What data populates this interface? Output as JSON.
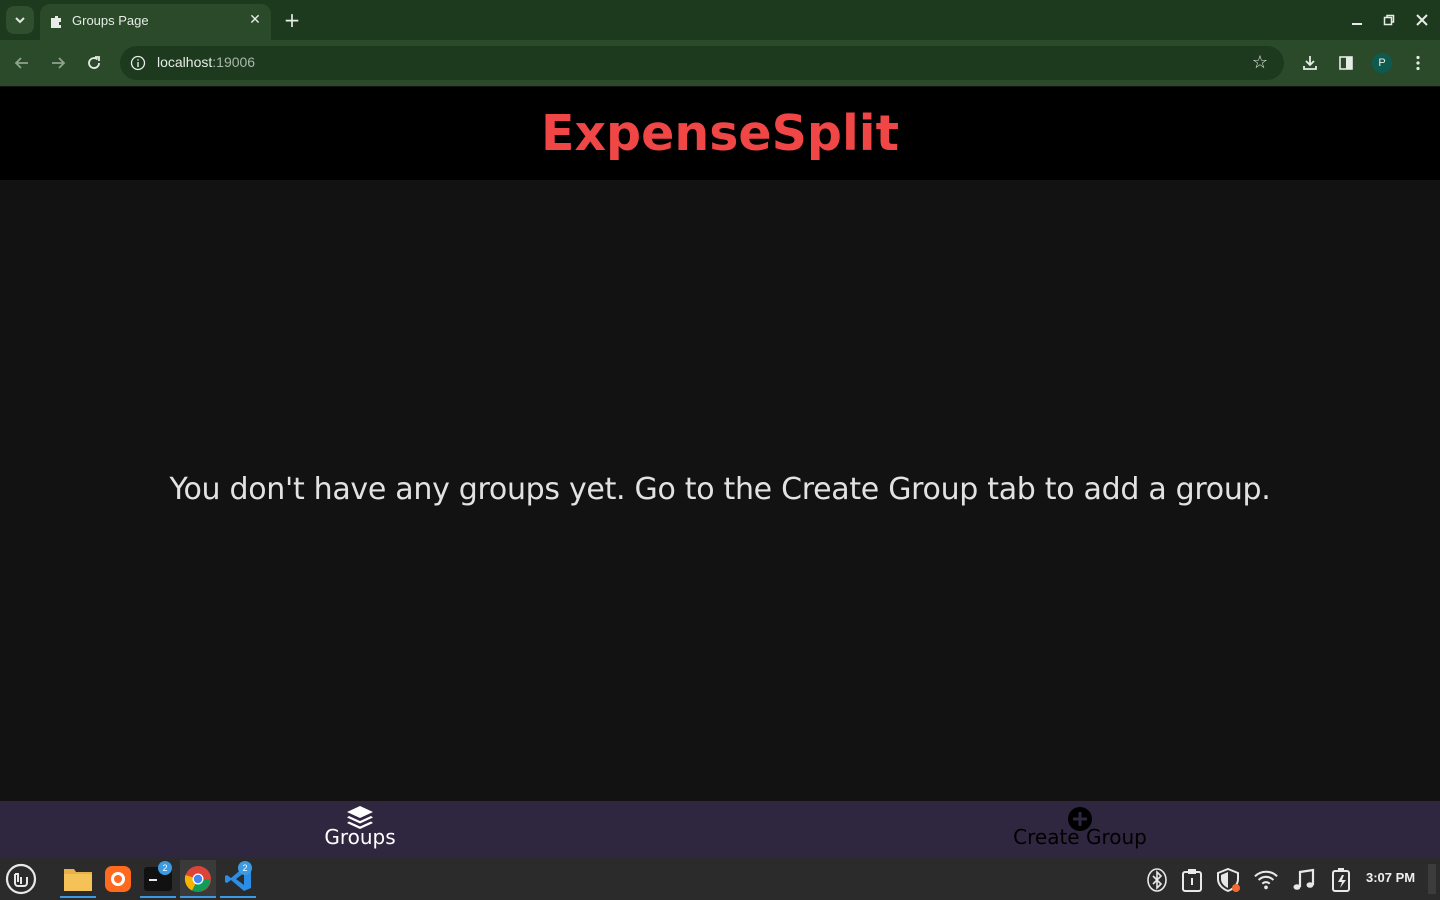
{
  "browser": {
    "tab_title": "Groups Page",
    "url_host": "localhost",
    "url_port": ":19006",
    "profile_initial": "P"
  },
  "app": {
    "title": "ExpenseSplit",
    "title_color": "#f04646",
    "empty_message": "You don't have any groups yet. Go to the Create Group tab to add a group.",
    "nav": {
      "groups_label": "Groups",
      "groups_color": "#ffffff",
      "create_label": "Create Group",
      "create_color": "#000000",
      "background": "#2f2640"
    }
  },
  "taskbar": {
    "terminal_badge": "2",
    "vscode_badge": "2",
    "clock": "3:07 PM"
  },
  "icons": [
    "chevron-down-icon",
    "puzzle-favicon-icon",
    "close-icon",
    "plus-icon",
    "minimize-icon",
    "maximize-icon",
    "back-icon",
    "forward-icon",
    "reload-icon",
    "site-info-icon",
    "star-icon",
    "download-icon",
    "sidebar-icon",
    "menu-dots-icon",
    "layers-icon",
    "plus-circle-icon",
    "mint-menu-icon",
    "files-icon",
    "firefox-icon",
    "terminal-icon",
    "chrome-icon",
    "vscode-icon",
    "bluetooth-icon",
    "clipboard-icon",
    "shield-icon",
    "wifi-icon",
    "music-icon",
    "battery-icon"
  ]
}
